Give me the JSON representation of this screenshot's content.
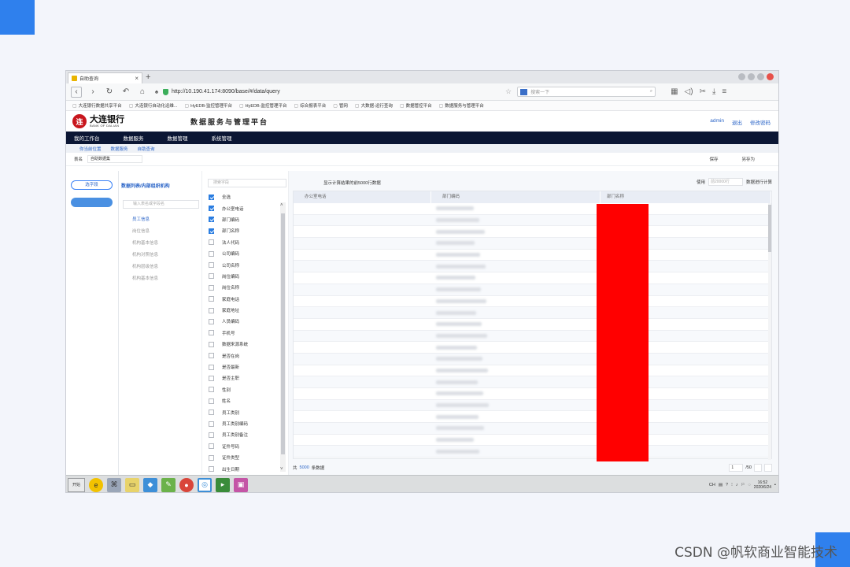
{
  "browser": {
    "tab_title": "自助查询",
    "url": "http://10.190.41.174:8090/base/#/data/query",
    "search_placeholder": "搜索一下",
    "bookmarks": [
      "大连银行数据共享平台",
      "大连银行自动化运维...",
      "HyEDB-监控管理平台",
      "HyEDB-监控管理平台",
      "综合报表平台",
      "管网",
      "大数据-运行查询",
      "数据管控平台",
      "数据服务与管理平台"
    ]
  },
  "header": {
    "bank_name": "大连银行",
    "bank_name_en": "BANK OF DALIAN",
    "platform_title": "数据服务与管理平台",
    "user": "admin",
    "logout": "退出",
    "change_password": "修改密码"
  },
  "menu": [
    "我的工作台",
    "数据服务",
    "数据管理",
    "系统管理"
  ],
  "breadcrumb": [
    "你当前位置",
    "数据服务",
    "自助查询"
  ],
  "table_bar": {
    "label": "表名",
    "value": "自助数据集",
    "save": "保存",
    "save_as": "另存为"
  },
  "left_panel": {
    "button": "选字段"
  },
  "tree": {
    "title": "数据列表/内部组织机构",
    "search_placeholder": "输入表名或字段名",
    "items": [
      "员工信息",
      "岗位信息",
      "机构基本信息",
      "机构对照信息",
      "机构层级信息",
      "机构基本信息"
    ],
    "active_index": 0
  },
  "fields": {
    "search_placeholder": "搜索字段",
    "items": [
      {
        "label": "全选",
        "checked": true
      },
      {
        "label": "办公室电话",
        "checked": true
      },
      {
        "label": "部门编码",
        "checked": true
      },
      {
        "label": "部门名称",
        "checked": true
      },
      {
        "label": "法人代码",
        "checked": false
      },
      {
        "label": "公司编码",
        "checked": false
      },
      {
        "label": "公司名称",
        "checked": false
      },
      {
        "label": "岗位编码",
        "checked": false
      },
      {
        "label": "岗位名称",
        "checked": false
      },
      {
        "label": "家庭电话",
        "checked": false
      },
      {
        "label": "家庭地址",
        "checked": false
      },
      {
        "label": "人员编码",
        "checked": false
      },
      {
        "label": "手机号",
        "checked": false
      },
      {
        "label": "数据来源系统",
        "checked": false
      },
      {
        "label": "是否在岗",
        "checked": false
      },
      {
        "label": "是否最新",
        "checked": false
      },
      {
        "label": "是否主职",
        "checked": false
      },
      {
        "label": "性别",
        "checked": false
      },
      {
        "label": "姓名",
        "checked": false
      },
      {
        "label": "员工类别",
        "checked": false
      },
      {
        "label": "员工类别编码",
        "checked": false
      },
      {
        "label": "员工类别备注",
        "checked": false
      },
      {
        "label": "证件号码",
        "checked": false
      },
      {
        "label": "证件类型",
        "checked": false
      },
      {
        "label": "出生日期",
        "checked": false
      }
    ]
  },
  "result": {
    "notice": "显示计算结果的前5000行数据",
    "use_label": "使用",
    "use_placeholder": "前20000行",
    "compute_label": "数据进行计算",
    "columns": [
      "办公室电话",
      "部门编码",
      "部门名称"
    ],
    "row_count": 22,
    "total_prefix": "共",
    "total": "5000",
    "total_suffix": "条数据",
    "page": "1",
    "pages": "/50"
  },
  "taskbar": {
    "start": "开始",
    "time": "16:52",
    "date": "2020/6/24",
    "ime": "CH"
  },
  "watermark": "CSDN @帆软商业智能技术"
}
